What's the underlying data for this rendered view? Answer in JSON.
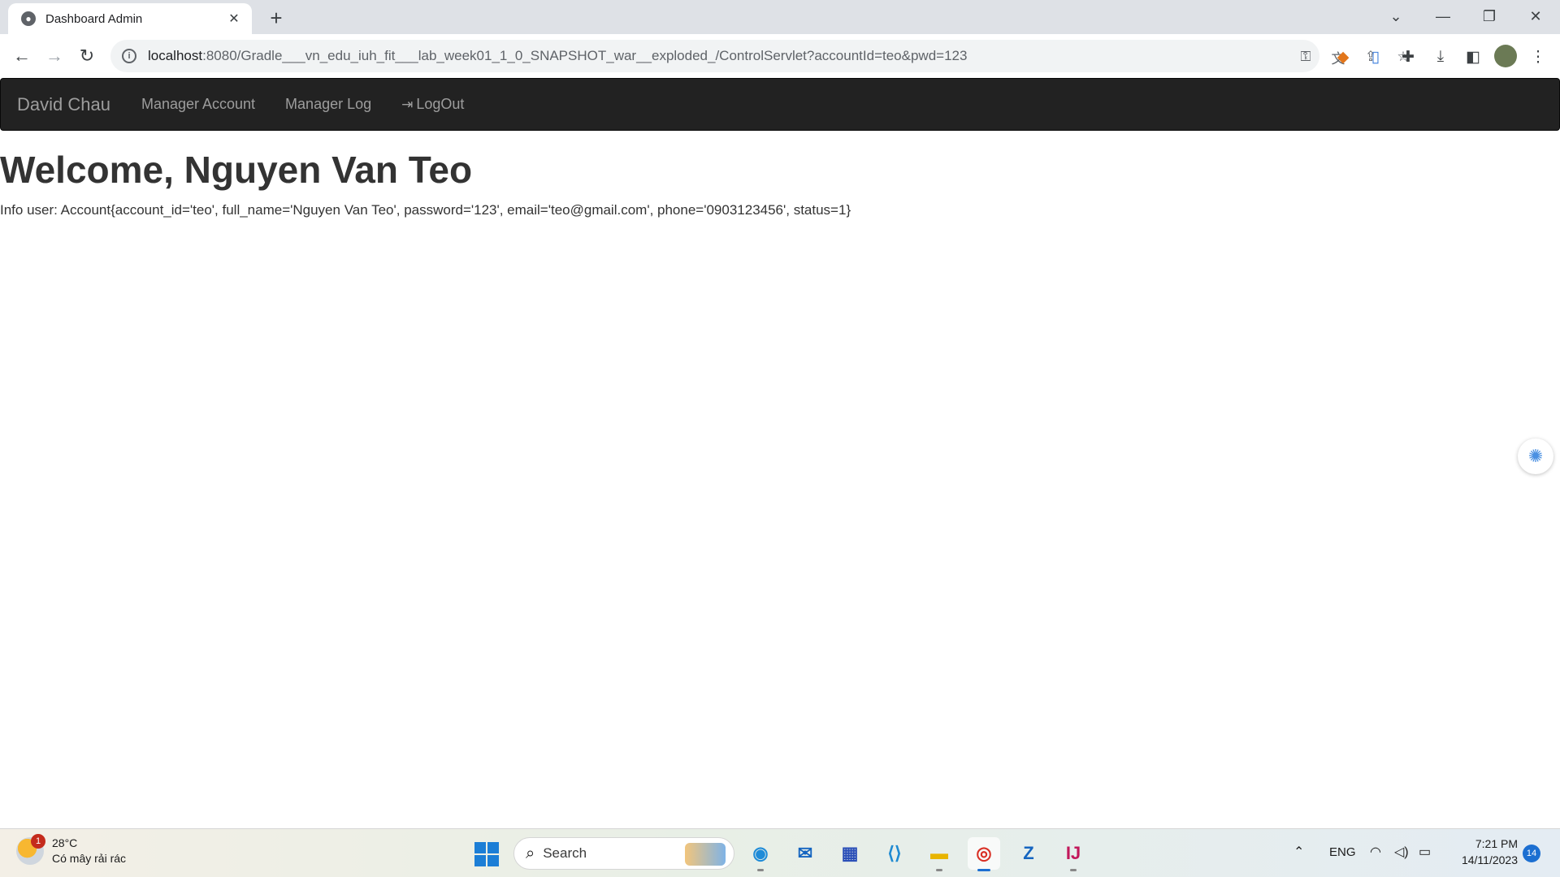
{
  "browser": {
    "tab_title": "Dashboard Admin",
    "tab_close": "✕",
    "new_tab": "+",
    "url_host": "localhost",
    "url_rest": ":8080/Gradle___vn_edu_iuh_fit___lab_week01_1_0_SNAPSHOT_war__exploded_/ControlServlet?accountId=teo&pwd=123"
  },
  "navbar": {
    "brand": "David Chau",
    "links": [
      "Manager Account",
      "Manager Log",
      "LogOut"
    ]
  },
  "main": {
    "heading": "Welcome, Nguyen Van Teo",
    "info": "Info user: Account{account_id='teo', full_name='Nguyen Van Teo', password='123', email='teo@gmail.com', phone='0903123456', status=1}"
  },
  "taskbar": {
    "weather_temp": "28°C",
    "weather_desc": "Có mây rải rác",
    "weather_badge": "1",
    "search_label": "Search",
    "lang": "ENG",
    "time": "7:21 PM",
    "date": "14/11/2023",
    "notifications": "14"
  },
  "colors": {
    "navbar_bg": "#222222",
    "navbar_text": "#9d9d9d",
    "accent_blue": "#1c6fd1"
  },
  "icons": {
    "favicon": "globe-icon",
    "info": "info-icon",
    "key": "key-icon",
    "translate": "translate-icon",
    "share": "share-icon",
    "bookmark": "star-icon",
    "metamask": "fox-icon",
    "extensions": "puzzle-icon",
    "download": "download-icon",
    "sidepanel": "side-panel-icon",
    "menu": "kebab-menu-icon"
  }
}
